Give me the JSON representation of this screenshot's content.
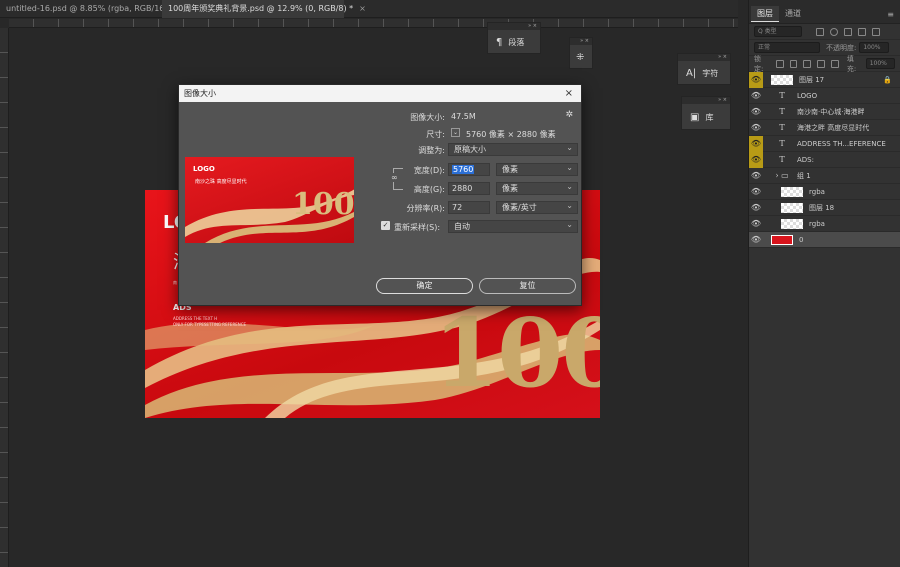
{
  "tabs": [
    {
      "label": "untitled-16.psd @ 8.85% (rgba, RGB/16#) *",
      "close": "×"
    },
    {
      "label": "100周年颁奖典礼背景.psd @ 12.9% (0, RGB/8) *",
      "close": "×"
    }
  ],
  "canvas_art": {
    "logo": "LOG",
    "headline": "海",
    "line1": "南",
    "ads": "ADS",
    "fine1": "ADDRESS THE TEXT H",
    "fine2": "ONLY FOR TYPESETTING REFERENCE",
    "big_number": "100"
  },
  "float_panels": {
    "paragraph": {
      "label": "段落",
      "icon": "¶"
    },
    "character": {
      "label": "字符",
      "icon": "A|"
    },
    "library": {
      "label": "库",
      "icon": "▣"
    },
    "header_controls": "»  ×"
  },
  "dock": {
    "tabs": [
      "图层",
      "通道"
    ],
    "active_tab": 0,
    "menu_icon": "≡",
    "search_placeholder": "Q 类型",
    "blend_mode": "正常",
    "opacity_label": "不透明度:",
    "opacity_value": "100%",
    "lock_label": "锁定:",
    "fill_label": "填充:",
    "fill_value": "100%",
    "layers": [
      {
        "name": "图层 17",
        "kind": "pixel",
        "flagged": true,
        "lock": true
      },
      {
        "name": "LOGO",
        "kind": "text",
        "flagged": false
      },
      {
        "name": "南沙南·中心城·海港畔",
        "kind": "text",
        "flagged": false
      },
      {
        "name": "海港之畔 高度尽显时代",
        "kind": "text",
        "flagged": false
      },
      {
        "name": "ADDRESS TH...EFERENCE",
        "kind": "text",
        "flagged": true
      },
      {
        "name": "ADS:",
        "kind": "text",
        "flagged": true
      },
      {
        "name": "组 1",
        "kind": "group",
        "flagged": false
      },
      {
        "name": "rgba",
        "kind": "pixel",
        "flagged": false
      },
      {
        "name": "图层 18",
        "kind": "smart",
        "flagged": false
      },
      {
        "name": "rgba",
        "kind": "pixel",
        "flagged": false
      },
      {
        "name": "0",
        "kind": "red",
        "flagged": false,
        "selected": true
      }
    ]
  },
  "dialog": {
    "title": "图像大小",
    "close": "×",
    "gear_icon": "✲",
    "image_size_label": "图像大小:",
    "image_size_value": "47.5M",
    "dimensions_label": "尺寸:",
    "dimensions_value": "5760 像素 × 2880 像素",
    "fit_label": "调整为:",
    "fit_value": "原稿大小",
    "width_label": "宽度(D):",
    "width_value": "5760",
    "width_unit": "像素",
    "height_label": "高度(G):",
    "height_value": "2880",
    "height_unit": "像素",
    "resolution_label": "分辨率(R):",
    "resolution_value": "72",
    "resolution_unit": "像素/英寸",
    "resample_label": "重新采样(S):",
    "resample_value": "自动",
    "resample_checked": true,
    "ok_label": "确定",
    "reset_label": "复位",
    "preview": {
      "logo": "LOGO",
      "sub": "南沙之珠 高度尽显时代",
      "number": "100"
    }
  },
  "colors": {
    "accent_yellow": "#b89b16",
    "canvas_red": "#d5101a",
    "gold": "#c9a86a",
    "selection_blue": "#2b6fd6"
  }
}
